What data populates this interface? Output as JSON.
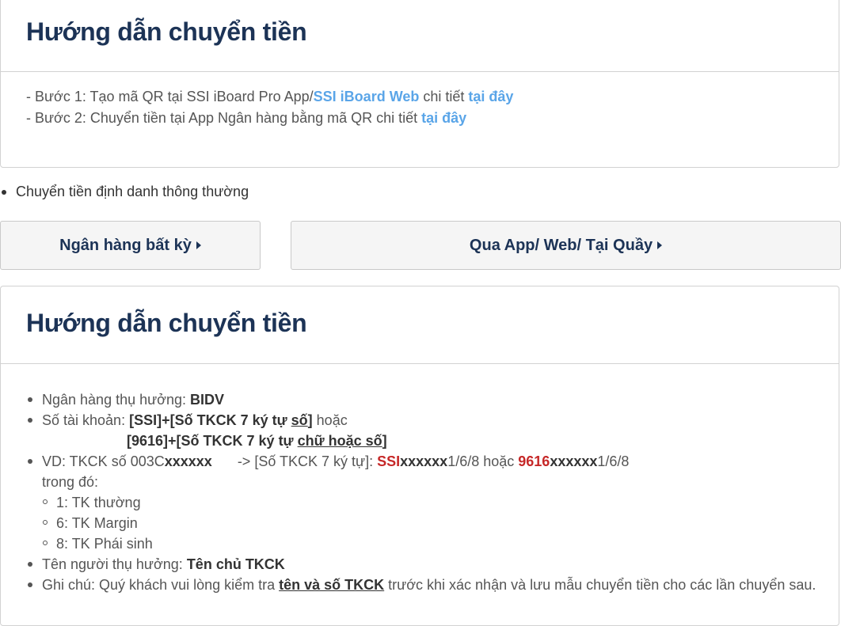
{
  "top_card": {
    "title": "Hướng dẫn chuyển tiền",
    "step1_prefix": "- Bước 1: Tạo mã QR tại SSI iBoard Pro App/",
    "step1_link_web": "SSI iBoard Web",
    "step1_mid": " chi tiết ",
    "step1_link_here": "tại đây",
    "step2_prefix": "- Bước 2: Chuyển tiền tại App Ngân hàng bằng mã QR chi tiết ",
    "step2_link_here": "tại đây"
  },
  "bullet": {
    "label": "Chuyển tiền định danh thông thường"
  },
  "buttons": {
    "bank_label": "Ngân hàng bất kỳ",
    "app_label": "Qua App/ Web/ Tại Quầy"
  },
  "bottom_card": {
    "title": "Hướng dẫn chuyển tiền",
    "bank_prefix": "Ngân hàng thụ hưởng: ",
    "bank_value": "BIDV",
    "account_prefix": "Số tài khoản:  ",
    "account_line1_a": "[SSI]+[Số TKCK 7 ký tự ",
    "account_line1_u": "số",
    "account_line1_b": "]",
    "account_or": " hoặc",
    "account_line2_a": "[9616]+[Số TKCK 7 ký tự ",
    "account_line2_u": "chữ hoặc số",
    "account_line2_b": "]",
    "example_prefix": "VD: TKCK số 003C",
    "example_x": "xxxxxx",
    "example_arrow": "-> [Số TKCK 7 ký tự]: ",
    "example_ssi": "SSI",
    "example_x2": "xxxxxx",
    "example_suffix1": "1/6/8 hoặc ",
    "example_9616": "9616",
    "example_x3": "xxxxxx",
    "example_suffix2": "1/6/8",
    "where_label": "trong đó:",
    "types": [
      "1: TK thường",
      "6: TK Margin",
      "8: TK Phái sinh"
    ],
    "beneficiary_prefix": "Tên người thụ hưởng: ",
    "beneficiary_value": "Tên chủ TKCK",
    "note_prefix": "Ghi chú: Quý khách vui lòng kiểm tra ",
    "note_u": "tên và số TKCK",
    "note_suffix": " trước khi xác nhận và lưu mẫu chuyển tiền cho các lần chuyển sau."
  },
  "colors": {
    "title": "#1c3356",
    "link": "#5aa5e8",
    "highlight_red": "#c62828",
    "border": "#d2d2d2"
  }
}
